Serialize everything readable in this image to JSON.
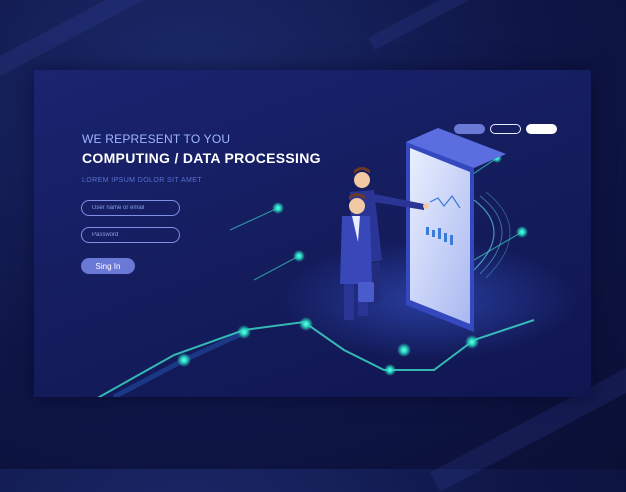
{
  "header": {
    "kicker": "WE REPRESENT TO YOU",
    "title": "COMPUTING / DATA PROCESSING",
    "subtitle": "LOREM IPSUM DOLOR SIT AMET"
  },
  "form": {
    "email_placeholder": "User name or email",
    "password_placeholder": "Password",
    "signin_label": "Sing In"
  },
  "nav": {
    "indicators": [
      "active-muted",
      "outline",
      "filled-white"
    ]
  },
  "colors": {
    "background": "#0f1647",
    "panel": "#1a2470",
    "accent": "#6a78d6",
    "glow": "#39f0d0",
    "text_light": "#ffffff",
    "text_muted": "#9fb7ff"
  }
}
